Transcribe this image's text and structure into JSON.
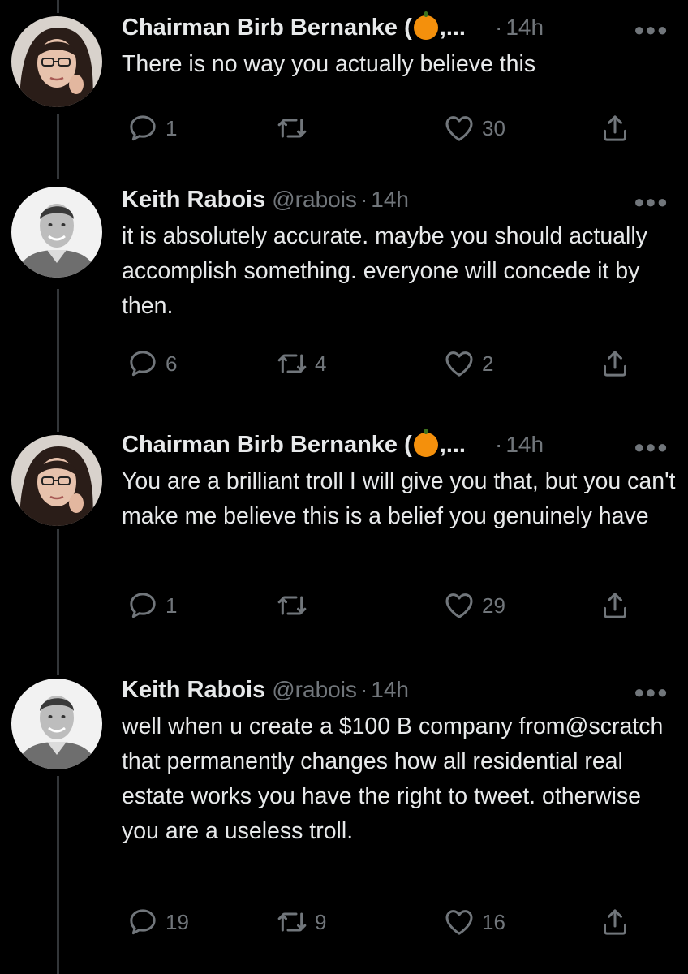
{
  "tweets": [
    {
      "name": "Chairman Birb Bernanke (",
      "name_suffix": ",...",
      "has_pumpkin": true,
      "handle": "",
      "separator": "·",
      "time": "14h",
      "text": "There is no way you actually believe this",
      "replies": "1",
      "retweets": "",
      "likes": "30",
      "avatar": "woman-glasses"
    },
    {
      "name": "Keith Rabois",
      "name_suffix": "",
      "has_pumpkin": false,
      "handle": "@rabois",
      "separator": "·",
      "time": "14h",
      "text": "it is absolutely accurate.  maybe you should actually accomplish something.  everyone will concede it by then.",
      "replies": "6",
      "retweets": "4",
      "likes": "2",
      "avatar": "man-smiling"
    },
    {
      "name": "Chairman Birb Bernanke (",
      "name_suffix": ",...",
      "has_pumpkin": true,
      "handle": "",
      "separator": "·",
      "time": "14h",
      "text": "You are a brilliant troll I will give you that, but you can't make me believe this is a belief you genuinely have",
      "replies": "1",
      "retweets": "",
      "likes": "29",
      "avatar": "woman-glasses"
    },
    {
      "name": "Keith Rabois",
      "name_suffix": "",
      "has_pumpkin": false,
      "handle": "@rabois",
      "separator": "·",
      "time": "14h",
      "text": "well when u create a $100 B company from@scratch that permanently changes how all residential real estate works you have the right to tweet.  otherwise you are a useless troll.",
      "replies": "19",
      "retweets": "9",
      "likes": "16",
      "avatar": "man-smiling"
    }
  ],
  "icons": {
    "more": "more-icon",
    "reply": "reply-icon",
    "retweet": "retweet-icon",
    "like": "heart-icon",
    "share": "share-icon",
    "pumpkin": "pumpkin-emoji-icon"
  },
  "colors": {
    "background": "#000000",
    "text": "#e7e9ea",
    "secondary": "#71767b",
    "thread_line": "#333639"
  }
}
